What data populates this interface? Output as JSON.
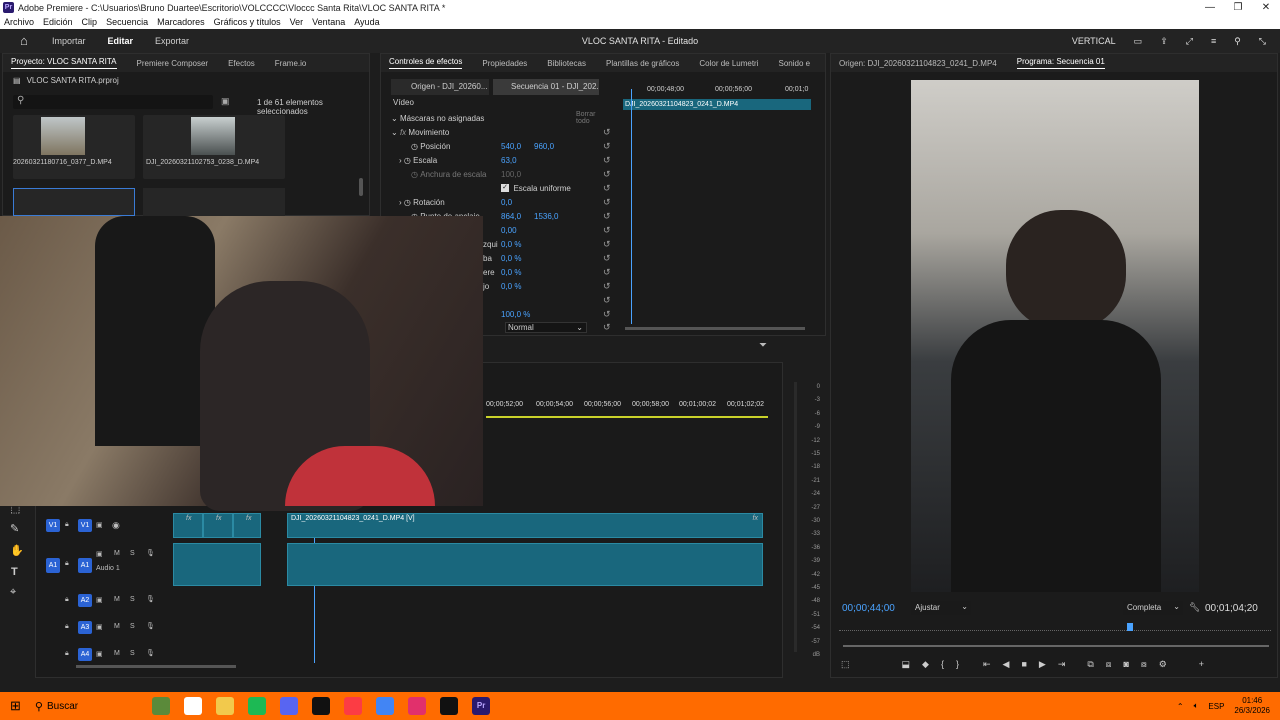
{
  "window": {
    "title": "Adobe Premiere - C:\\Usuarios\\Bruno Duartee\\Escritorio\\VOLCCCC\\Vloccc Santa Rita\\VLOC SANTA RITA *",
    "app_badge": "Pr",
    "controls": [
      "—",
      "❐",
      "✕"
    ]
  },
  "menu": [
    "Archivo",
    "Edición",
    "Clip",
    "Secuencia",
    "Marcadores",
    "Gráficos y títulos",
    "Ver",
    "Ventana",
    "Ayuda"
  ],
  "header": {
    "nav": [
      "Importar",
      "Editar",
      "Exportar"
    ],
    "project_title": "VLOC SANTA RITA - Editado",
    "workspace": "VERTICAL"
  },
  "project_panel": {
    "tabs": [
      "Proyecto: VLOC SANTA RITA",
      "Premiere Composer",
      "Efectos",
      "Frame.io"
    ],
    "file": "VLOC SANTA RITA.prproj",
    "selection": "1 de 61 elementos seleccionados",
    "items": [
      {
        "name": "20260321180716_0377_D.MP4"
      },
      {
        "name": "DJI_20260321102753_0238_D.MP4"
      }
    ]
  },
  "effect_controls": {
    "tabs": [
      "Controles de efectos",
      "Propiedades",
      "Bibliotecas",
      "Plantillas de gráficos",
      "Color de Lumetri",
      "Sonido e"
    ],
    "source_tab": "Origen - DJI_20260...",
    "sequence_tab": "Secuencia 01 - DJI_202...",
    "section": "Vídeo",
    "masks": "Máscaras no asignadas",
    "clear_all": "Borrar todo",
    "motion": "Movimiento",
    "position_label": "Posición",
    "position_x": "540,0",
    "position_y": "960,0",
    "scale_label": "Escala",
    "scale": "63,0",
    "scale_width_label": "Anchura de escala",
    "scale_width": "100,0",
    "uniform_label": "Escala uniforme",
    "rotation_label": "Rotación",
    "rotation": "0,0",
    "anchor_label": "Punto de anclaje",
    "anchor_x": "864,0",
    "anchor_y": "1536,0",
    "antiflicker": "0,00",
    "crop_left_label": "zqui",
    "crop_left": "0,0 %",
    "crop_top_label": "ba",
    "crop_top": "0,0 %",
    "crop_right_label": "ere",
    "crop_right": "0,0 %",
    "crop_bottom_label": "jo",
    "crop_bottom": "0,0 %",
    "opacity": "100,0 %",
    "blend_mode": "Normal",
    "mini_ruler": [
      "00;00;48;00",
      "00;00;56;00",
      "00;01;0"
    ],
    "mini_clip": "DJI_20260321104823_0241_D.MP4"
  },
  "timeline": {
    "ruler": [
      "00;00;52;00",
      "00;00;54;00",
      "00;00;56;00",
      "00;00;58;00",
      "00;01;00;02",
      "00;01;02;02"
    ],
    "tracks": {
      "v1": {
        "name": "V1",
        "source": "V1"
      },
      "a1": {
        "name": "A1",
        "source": "A1",
        "label": "Audio 1"
      },
      "a2": {
        "name": "A2"
      },
      "a3": {
        "name": "A3"
      },
      "a4": {
        "name": "A4"
      }
    },
    "clip_label": "DJI_20260321104823_0241_D.MP4 [V]",
    "fx": "fx",
    "m": "M",
    "s": "S"
  },
  "audio_meter": {
    "labels": [
      "0",
      "-3",
      "-6",
      "-9",
      "-12",
      "-15",
      "-18",
      "-21",
      "-24",
      "-27",
      "-30",
      "-33",
      "-36",
      "-39",
      "-42",
      "-45",
      "-48",
      "-51",
      "-54",
      "-57",
      "dB"
    ]
  },
  "program_monitor": {
    "source_tab": "Origen: DJI_20260321104823_0241_D.MP4",
    "program_tab": "Programa: Secuencia 01",
    "timecode": "00;00;44;00",
    "fit": "Ajustar",
    "quality": "Completa",
    "duration": "00;01;04;20"
  },
  "taskbar": {
    "search": "Buscar",
    "lang": "ESP",
    "time": "01:46",
    "date": "26/3/2026"
  },
  "colors": {
    "accent": "#2b63d4",
    "timecode": "#4aa3ff",
    "clip": "#19677d",
    "taskbar": "#ff6b00",
    "playhead": "#4aa3ff"
  }
}
